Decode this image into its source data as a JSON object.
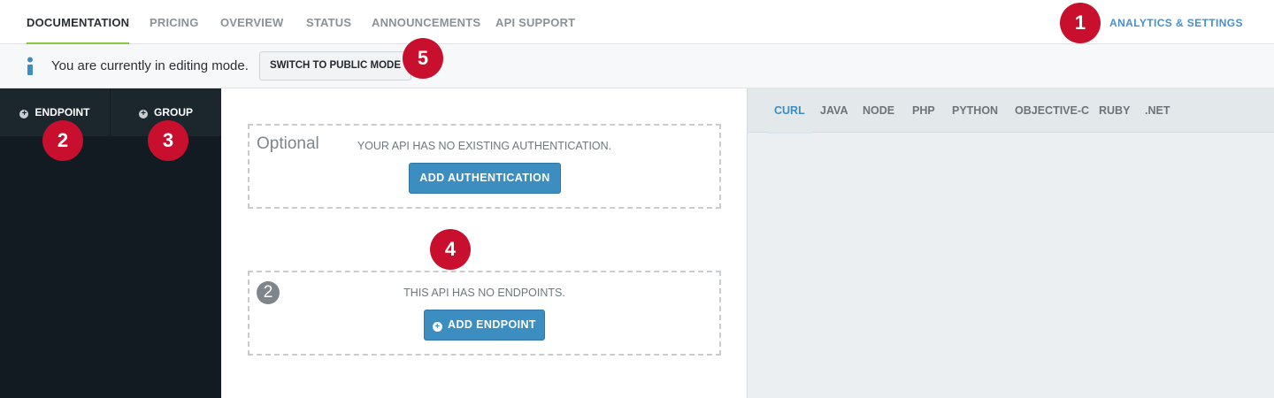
{
  "nav": {
    "tabs": [
      {
        "label": "DOCUMENTATION",
        "active": true
      },
      {
        "label": "PRICING",
        "active": false
      },
      {
        "label": "OVERVIEW",
        "active": false
      },
      {
        "label": "STATUS",
        "active": false
      },
      {
        "label": "ANNOUNCEMENTS",
        "active": false
      },
      {
        "label": "API SUPPORT",
        "active": false
      }
    ],
    "right_link": "ANALYTICS & SETTINGS"
  },
  "editbar": {
    "icon": "info-icon",
    "message": "You are currently in editing mode.",
    "button_label": "SWITCH TO PUBLIC MODE"
  },
  "sidebar": {
    "tabs": [
      {
        "label": "ENDPOINT",
        "icon": "plus-circle-icon"
      },
      {
        "label": "GROUP",
        "icon": "plus-circle-icon"
      }
    ]
  },
  "main": {
    "auth_box": {
      "tag": "Optional",
      "message": "YOUR API HAS NO EXISTING AUTHENTICATION.",
      "button_label": "ADD AUTHENTICATION"
    },
    "endpoint_box": {
      "number": "2",
      "message": "THIS API HAS NO ENDPOINTS.",
      "button_label": "ADD ENDPOINT"
    }
  },
  "code_panel": {
    "languages": [
      {
        "label": "CURL",
        "active": true
      },
      {
        "label": "JAVA",
        "active": false
      },
      {
        "label": "NODE",
        "active": false
      },
      {
        "label": "PHP",
        "active": false
      },
      {
        "label": "PYTHON",
        "active": false
      },
      {
        "label": "OBJECTIVE-C",
        "active": false
      },
      {
        "label": "RUBY",
        "active": false
      },
      {
        "label": ".NET",
        "active": false
      }
    ]
  },
  "markers": [
    "1",
    "2",
    "3",
    "4",
    "5"
  ],
  "colors": {
    "accent_blue": "#3c8dc0",
    "active_underline": "#8cc63f",
    "marker_red": "#c8102e",
    "sidebar_bg": "#111b21"
  }
}
